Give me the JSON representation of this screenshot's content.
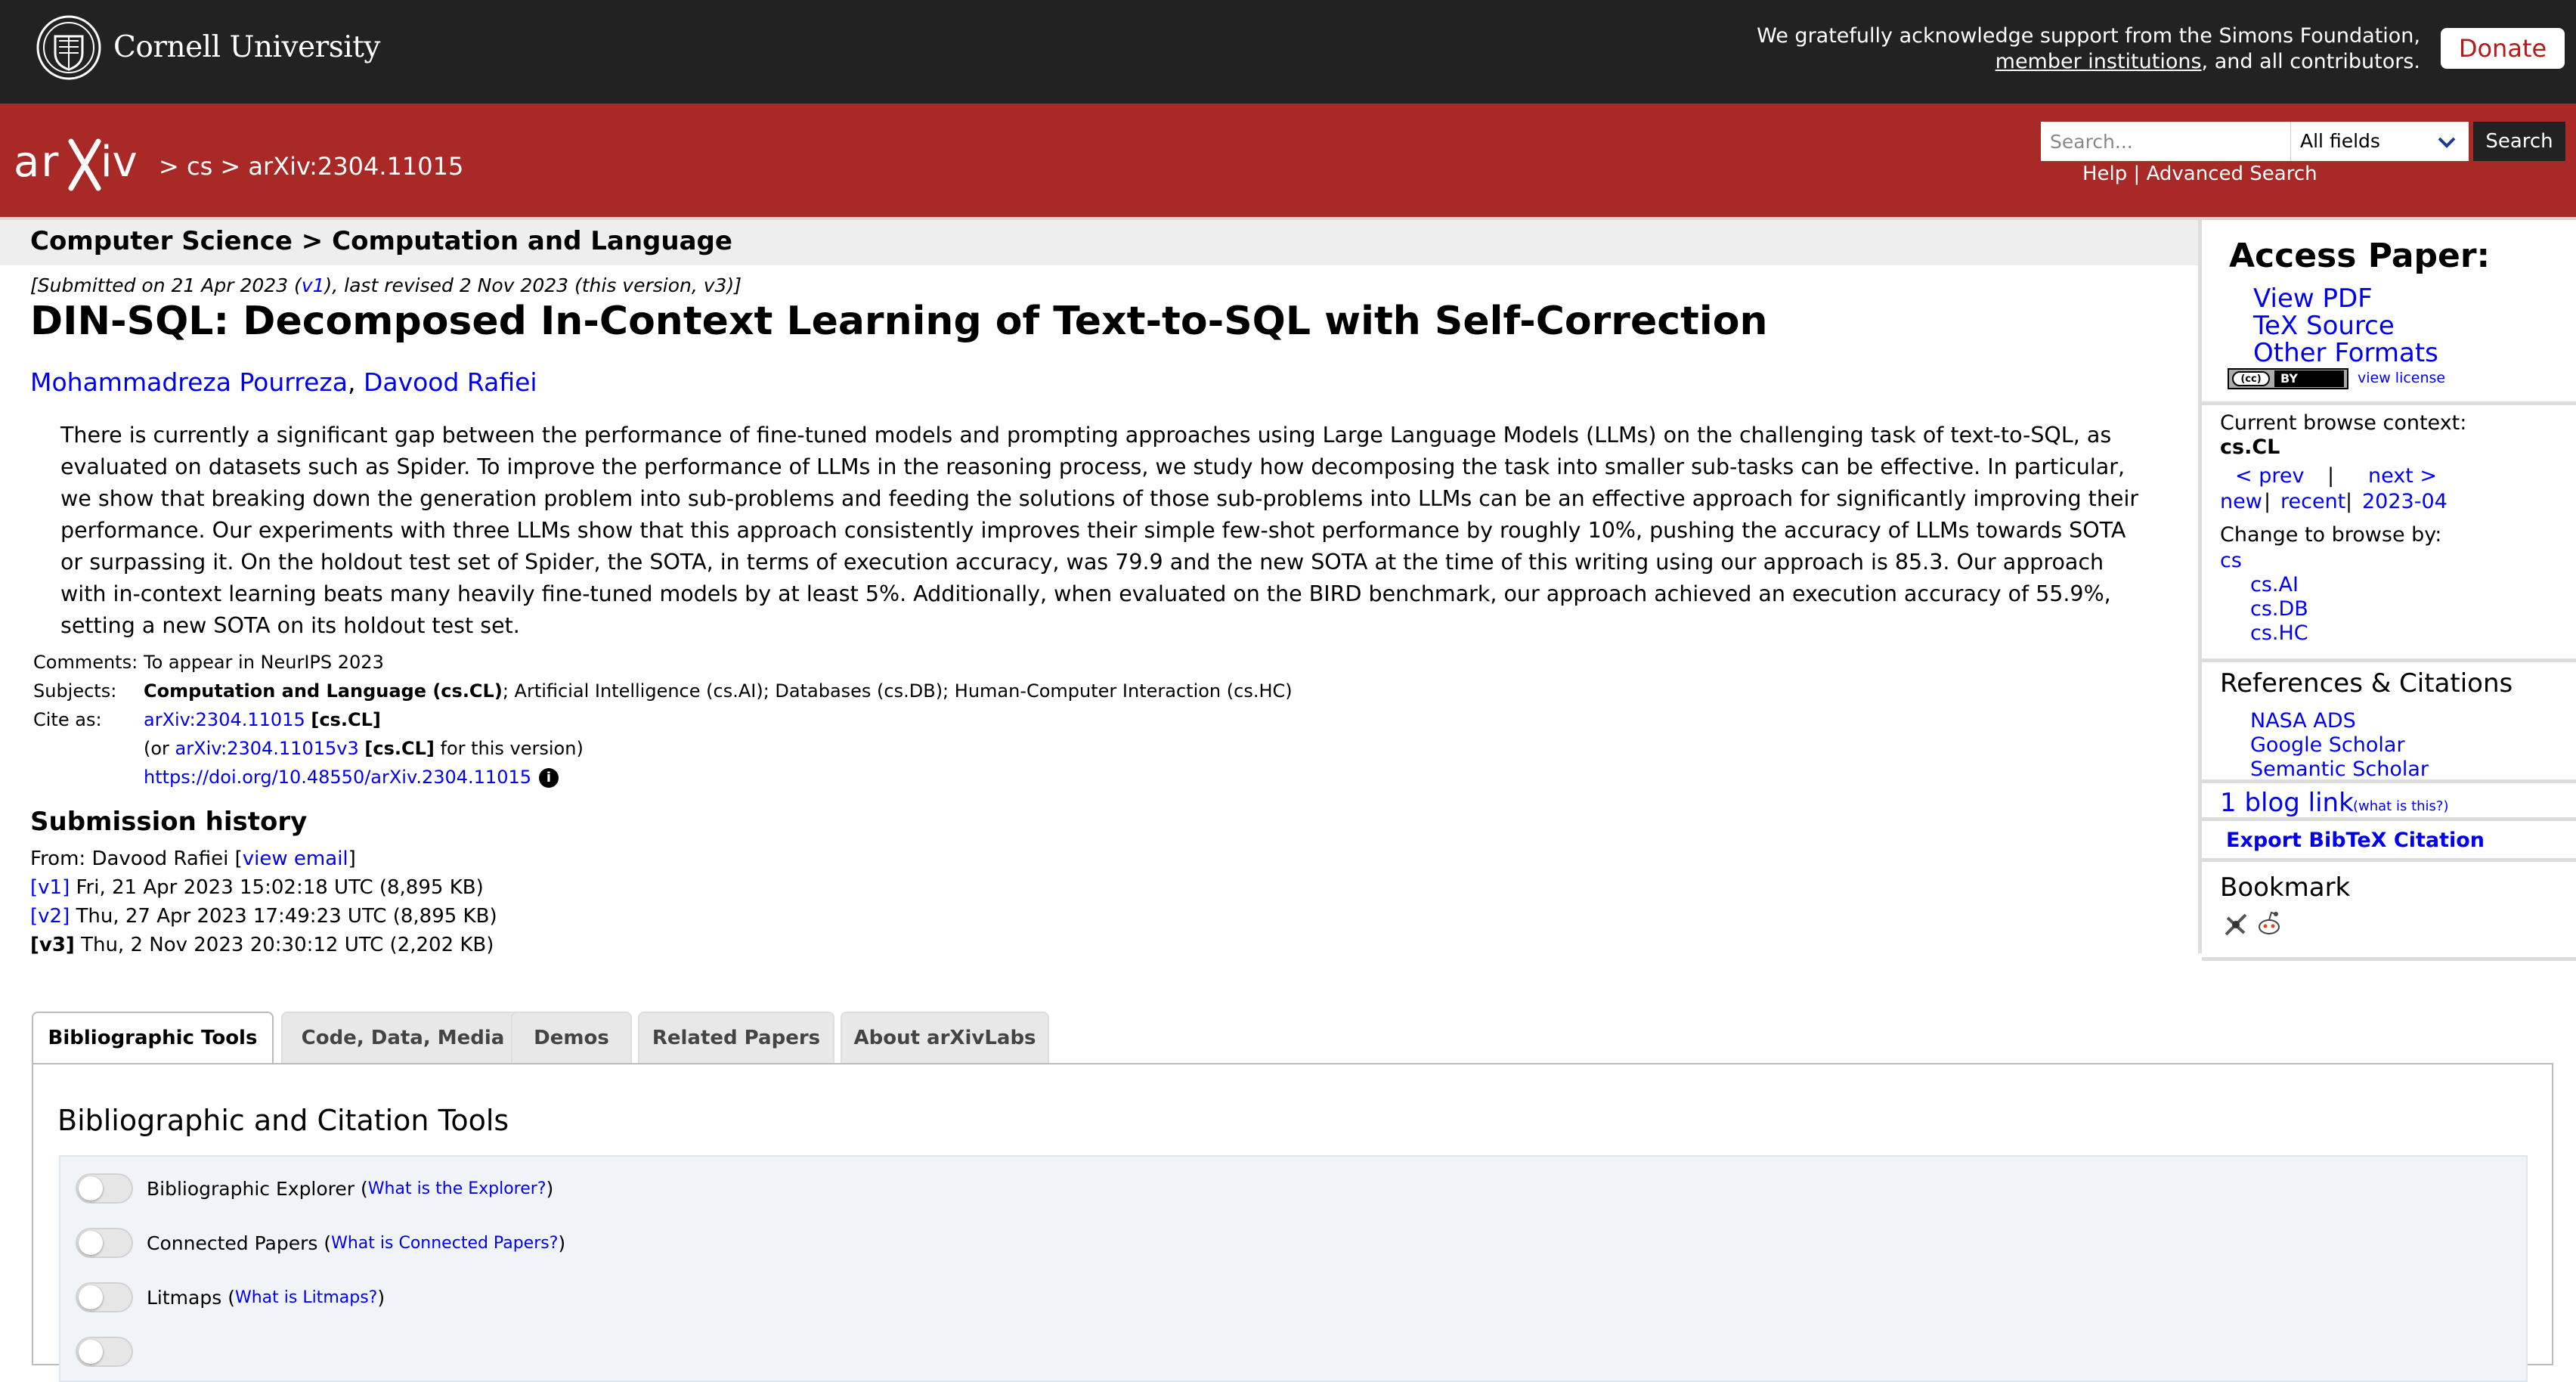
{
  "top": {
    "university": "Cornell University",
    "support_line1": "We gratefully acknowledge support from the Simons Foundation,",
    "support_link": "member institutions",
    "support_line2_rest": ", and all contributors.",
    "donate": "Donate"
  },
  "header": {
    "logo_text": "arXiv",
    "breadcrumb": "> cs > arXiv:2304.11015",
    "search_placeholder": "Search...",
    "field_selected": "All fields",
    "search_button": "Search",
    "help": "Help",
    "separator": "|",
    "advanced": "Advanced Search"
  },
  "subject_header": "Computer Science > Computation and Language",
  "dateline": {
    "prefix": "[Submitted on 21 Apr 2023 (",
    "v1": "v1",
    "suffix": "), last revised 2 Nov 2023 (this version, v3)]"
  },
  "title": "DIN-SQL: Decomposed In-Context Learning of Text-to-SQL with Self-Correction",
  "authors": [
    "Mohammadreza Pourreza",
    "Davood Rafiei"
  ],
  "author_sep": ", ",
  "abstract": "There is currently a significant gap between the performance of fine-tuned models and prompting approaches using Large Language Models (LLMs) on the challenging task of text-to-SQL, as evaluated on datasets such as Spider. To improve the performance of LLMs in the reasoning process, we study how decomposing the task into smaller sub-tasks can be effective. In particular, we show that breaking down the generation problem into sub-problems and feeding the solutions of those sub-problems into LLMs can be an effective approach for significantly improving their performance. Our experiments with three LLMs show that this approach consistently improves their simple few-shot performance by roughly 10%, pushing the accuracy of LLMs towards SOTA or surpassing it. On the holdout test set of Spider, the SOTA, in terms of execution accuracy, was 79.9 and the new SOTA at the time of this writing using our approach is 85.3. Our approach with in-context learning beats many heavily fine-tuned models by at least 5%. Additionally, when evaluated on the BIRD benchmark, our approach achieved an execution accuracy of 55.9%, setting a new SOTA on its holdout test set.",
  "meta": {
    "comments_label": "Comments:",
    "comments": "To appear in NeurIPS 2023",
    "subjects_label": "Subjects:",
    "subjects_primary": "Computation and Language (cs.CL)",
    "subjects_rest": "; Artificial Intelligence (cs.AI); Databases (cs.DB); Human-Computer Interaction (cs.HC)",
    "cite_label": "Cite as:",
    "cite_id": "arXiv:2304.11015",
    "cite_cat": "[cs.CL]",
    "cite2_prefix": "(or ",
    "cite2_id": "arXiv:2304.11015v3",
    "cite2_cat": "[cs.CL]",
    "cite2_suffix": " for this version)",
    "doi": "https://doi.org/10.48550/arXiv.2304.11015",
    "info_glyph": "i"
  },
  "history": {
    "title": "Submission history",
    "from_prefix": "From: Davood Rafiei [",
    "view_email": "view email",
    "from_suffix": "]",
    "versions": [
      {
        "tag": "[v1]",
        "text": " Fri, 21 Apr 2023 15:02:18 UTC (8,895 KB)"
      },
      {
        "tag": "[v2]",
        "text": " Thu, 27 Apr 2023 17:49:23 UTC (8,895 KB)"
      },
      {
        "tag": "[v3]",
        "text": " Thu, 2 Nov 2023 20:30:12 UTC (2,202 KB)"
      }
    ]
  },
  "sidebar": {
    "access_title": "Access Paper:",
    "view_pdf": "View PDF",
    "tex_source": "TeX Source",
    "other_formats": "Other Formats",
    "cc_left": "(cc)",
    "cc_right": "BY",
    "view_license": "view license",
    "browse_context_label": "Current browse context:",
    "browse_context": "cs.CL",
    "prev": "< prev",
    "pipe": "|",
    "next": "next >",
    "new": "new",
    "recent": "recent",
    "month": "2023-04",
    "change_label": "Change to browse by:",
    "browse_cats": [
      "cs",
      "cs.AI",
      "cs.DB",
      "cs.HC"
    ],
    "refs_title": "References & Citations",
    "refs": [
      "NASA ADS",
      "Google Scholar",
      "Semantic Scholar"
    ],
    "blog_link": "1 blog link",
    "what_is_this": "(what is this?)",
    "export_bibtex": "Export BibTeX Citation",
    "bookmark": "Bookmark"
  },
  "tabs": [
    "Bibliographic Tools",
    "Code, Data, Media",
    "Demos",
    "Related Papers",
    "About arXivLabs"
  ],
  "panel": {
    "title": "Bibliographic and Citation Tools",
    "tools": [
      {
        "name": "Bibliographic Explorer",
        "help": "What is the Explorer?"
      },
      {
        "name": "Connected Papers",
        "help": "What is Connected Papers?"
      },
      {
        "name": "Litmaps",
        "help": "What is Litmaps?"
      }
    ]
  }
}
